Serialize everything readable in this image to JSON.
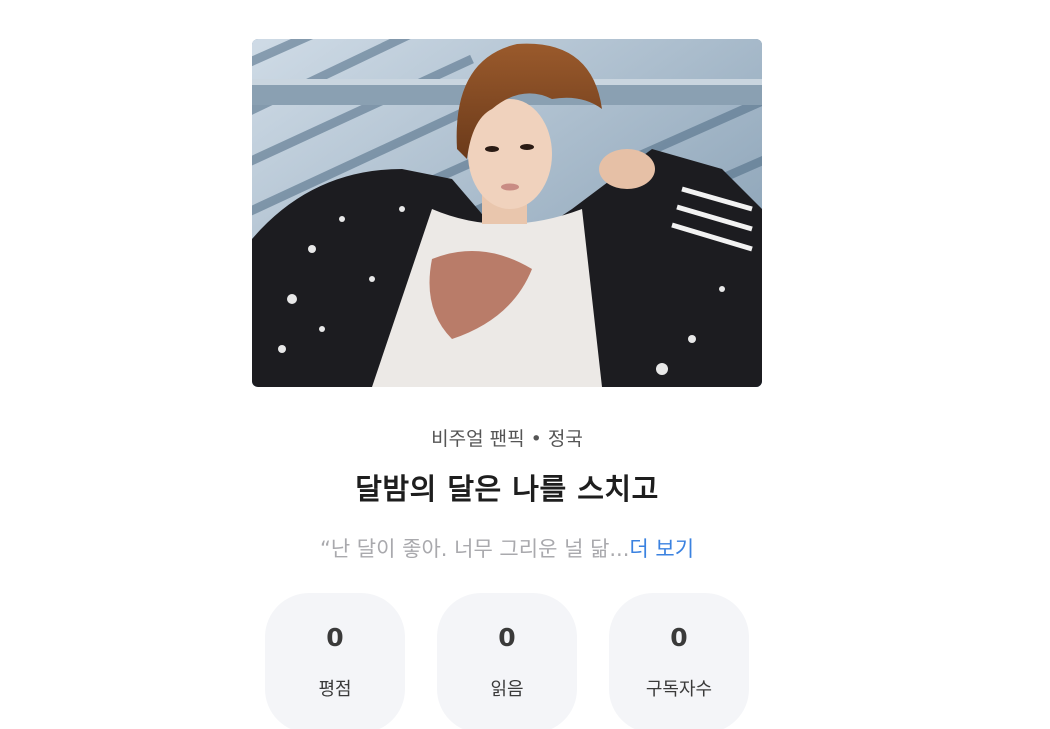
{
  "work": {
    "category": "비주얼 팬픽",
    "separator": "•",
    "character": "정국",
    "title": "달밤의 달은 나를 스치고",
    "synopsis": "“난 달이 좋아. 너무 그리운 널 닮...",
    "more_label": "더 보기"
  },
  "stats": [
    {
      "value": "0",
      "label": "평점"
    },
    {
      "value": "0",
      "label": "읽음"
    },
    {
      "value": "0",
      "label": "구독자수"
    }
  ],
  "colors": {
    "link": "#3b82e0",
    "stat_bg": "#f4f5f8",
    "muted_text": "#a9a9ad"
  }
}
